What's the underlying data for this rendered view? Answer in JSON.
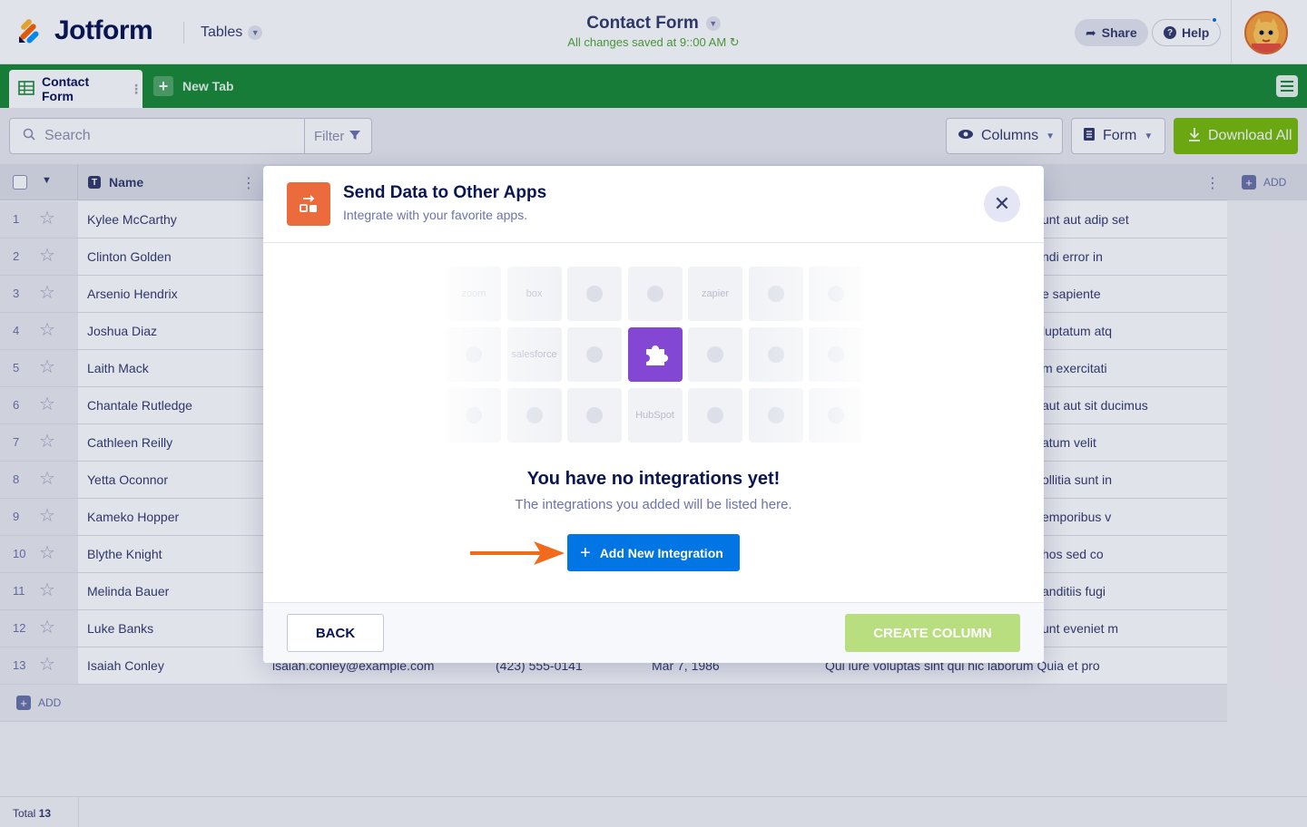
{
  "header": {
    "brand": "Jotform",
    "product_switch": "Tables",
    "form_title": "Contact Form",
    "save_status": "All changes saved at 9::00 AM",
    "share_label": "Share",
    "help_label": "Help"
  },
  "tabs": {
    "active_label": "Contact Form",
    "new_tab_label": "New Tab"
  },
  "toolbar": {
    "search_placeholder": "Search",
    "filter_label": "Filter",
    "columns_label": "Columns",
    "form_label": "Form",
    "download_label": "Download All"
  },
  "grid": {
    "name_header": "Name",
    "add_column_label": "ADD",
    "add_row_label": "ADD",
    "total_label": "Total",
    "total_count": "13",
    "rows": [
      {
        "num": "1",
        "name": "Kylee McCarthy",
        "right": "unt aut adip set"
      },
      {
        "num": "2",
        "name": "Clinton Golden",
        "right": "ndi error in"
      },
      {
        "num": "3",
        "name": "Arsenio Hendrix",
        "right": "e sapiente"
      },
      {
        "num": "4",
        "name": "Joshua Diaz",
        "right": "luptatum atq"
      },
      {
        "num": "5",
        "name": "Laith Mack",
        "right": "m exercitati"
      },
      {
        "num": "6",
        "name": "Chantale Rutledge",
        "right": "aut aut sit ducimus"
      },
      {
        "num": "7",
        "name": "Cathleen Reilly",
        "right": "atum velit"
      },
      {
        "num": "8",
        "name": "Yetta Oconnor",
        "right": "ollitia sunt in"
      },
      {
        "num": "9",
        "name": "Kameko Hopper",
        "right": "emporibus v"
      },
      {
        "num": "10",
        "name": "Blythe Knight",
        "right": "hos sed co"
      },
      {
        "num": "11",
        "name": "Melinda Bauer",
        "right": "anditiis fugi"
      },
      {
        "num": "12",
        "name": "Luke Banks",
        "right": "unt eveniet m"
      }
    ],
    "last_row": {
      "num": "13",
      "name": "Isaiah Conley",
      "email": "isaiah.conley@example.com",
      "phone": "(423) 555-0141",
      "date": "Mar 7, 1986",
      "text": "Qui iure voluptas sint qui hic laborum Quia et pro"
    }
  },
  "modal": {
    "title": "Send Data to Other Apps",
    "subtitle": "Integrate with your favorite apps.",
    "empty_title": "You have no integrations yet!",
    "empty_subtitle": "The integrations you added will be listed here.",
    "add_button": "Add New Integration",
    "back_button": "BACK",
    "create_button": "CREATE COLUMN",
    "tiles": [
      [
        "zoom",
        "box",
        "dropbox-icon",
        "calendar-icon",
        "zapier",
        "ms-icon",
        "cloud-icon"
      ],
      [
        "asana-icon",
        "salesforce",
        "mailchimp-icon",
        "puzzle-icon",
        "drive-icon",
        "slack-icon",
        "mail-icon"
      ],
      [
        "person-icon",
        "trello-icon",
        "arrows-icon",
        "HubSpot",
        "qb-icon",
        "nodes-icon",
        "circle-icon"
      ]
    ]
  },
  "colors": {
    "brand_green": "#1a8a35",
    "primary_blue": "#0075e3",
    "download_green": "#78bb07",
    "create_disabled": "#b8de80",
    "modal_icon": "#ec6b3d",
    "highlight_tile": "#8447d4",
    "arrow_orange": "#f26a1b"
  }
}
